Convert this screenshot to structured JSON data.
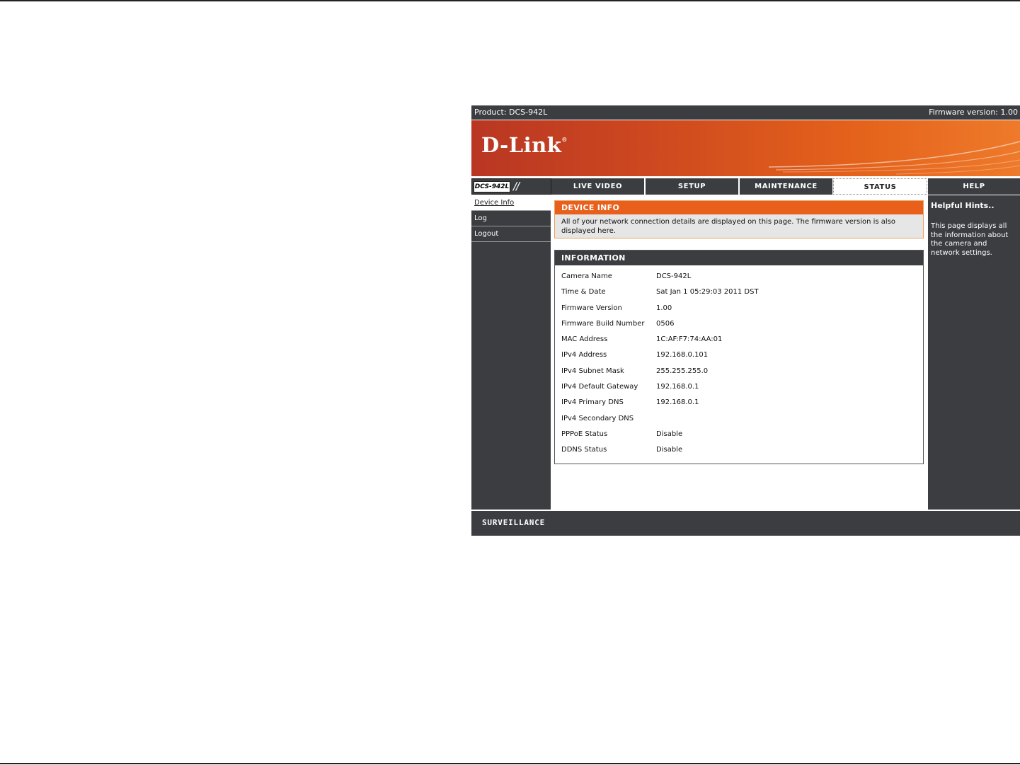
{
  "topbar": {
    "product": "Product: DCS-942L",
    "firmware": "Firmware version: 1.00"
  },
  "banner": {
    "logo": "D-Link",
    "logo_mark": "®"
  },
  "nav": {
    "model": "DCS-942L",
    "model_slashes": "//",
    "tabs": [
      {
        "label": "LIVE VIDEO"
      },
      {
        "label": "SETUP"
      },
      {
        "label": "MAINTENANCE"
      },
      {
        "label": "STATUS",
        "active": true
      },
      {
        "label": "HELP"
      }
    ]
  },
  "sidebar": {
    "items": [
      {
        "label": "Device Info",
        "active": true
      },
      {
        "label": "Log"
      },
      {
        "label": "Logout"
      }
    ]
  },
  "device_info": {
    "title": "DEVICE INFO",
    "description": "All of your network connection details are displayed on this page. The firmware version is also displayed here."
  },
  "information": {
    "title": "INFORMATION",
    "rows": [
      {
        "label": "Camera Name",
        "value": "DCS-942L"
      },
      {
        "label": "Time & Date",
        "value": "Sat Jan 1 05:29:03 2011 DST"
      },
      {
        "label": "Firmware Version",
        "value": "1.00"
      },
      {
        "label": "Firmware Build Number",
        "value": "0506"
      },
      {
        "label": "MAC Address",
        "value": "1C:AF:F7:74:AA:01"
      },
      {
        "label": "IPv4 Address",
        "value": "192.168.0.101"
      },
      {
        "label": "IPv4 Subnet Mask",
        "value": "255.255.255.0"
      },
      {
        "label": "IPv4 Default Gateway",
        "value": "192.168.0.1"
      },
      {
        "label": "IPv4 Primary DNS",
        "value": "192.168.0.1"
      },
      {
        "label": "IPv4 Secondary DNS",
        "value": ""
      },
      {
        "label": "PPPoE Status",
        "value": "Disable"
      },
      {
        "label": "DDNS Status",
        "value": "Disable"
      }
    ]
  },
  "help": {
    "title": "Helpful Hints..",
    "text": "This page displays all the information about the camera and network settings."
  },
  "footer": {
    "brand": "SURVEILLANCE"
  },
  "colors": {
    "dark": "#3b3d40",
    "accent_orange": "#e8601c",
    "banner_start": "#b93623",
    "banner_end": "#ee7a2b"
  }
}
